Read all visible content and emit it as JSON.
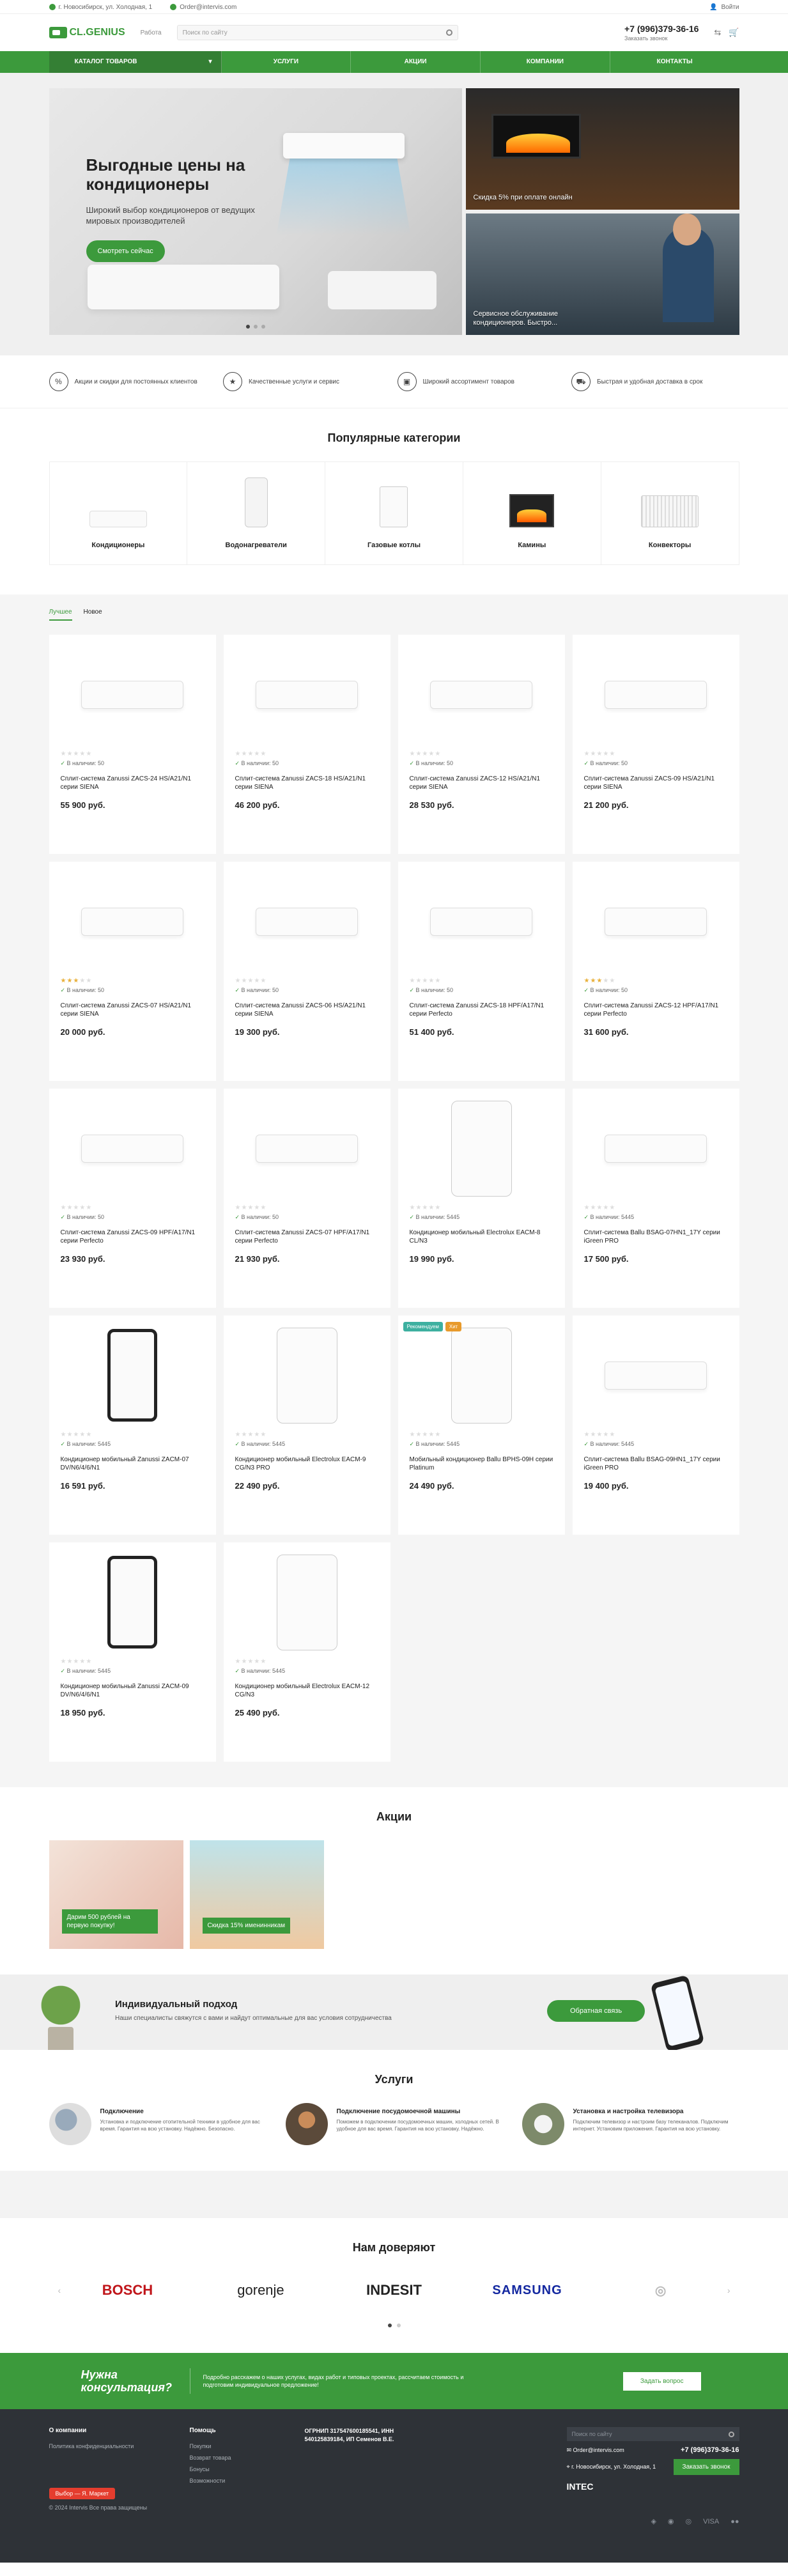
{
  "topbar": {
    "address": "г. Новосибирск, ул. Холодная, 1",
    "email": "Order@intervis.com",
    "right": "Войти"
  },
  "header": {
    "logo": "CL.GENIUS",
    "city": "Работа",
    "search_placeholder": "Поиск по сайту",
    "phone": "+7 (996)379-36-16",
    "callback": "Заказать звонок"
  },
  "nav": {
    "catalog": "Каталог товаров",
    "items": [
      "Услуги",
      "Акции",
      "Компании",
      "Контакты"
    ]
  },
  "hero": {
    "title": "Выгодные цены на кондиционеры",
    "text": "Широкий выбор кондиционеров от ведущих мировых производителей",
    "button": "Смотреть сейчас",
    "side1": "Скидка 5% при оплате онлайн",
    "side2": "Сервисное обслуживание кондиционеров. Быстро..."
  },
  "features": [
    {
      "icon": "percent-icon",
      "text": "Акции и скидки для постоянных клиентов"
    },
    {
      "icon": "award-icon",
      "text": "Качественные услуги и сервис"
    },
    {
      "icon": "shirt-icon",
      "text": "Широкий ассортимент товаров"
    },
    {
      "icon": "truck-icon",
      "text": "Быстрая и удобная доставка в срок"
    }
  ],
  "categories": {
    "title": "Популярные категории",
    "items": [
      "Кондиционеры",
      "Водонагреватели",
      "Газовые котлы",
      "Камины",
      "Конвекторы"
    ]
  },
  "tabs": [
    "Лучшее",
    "Новое"
  ],
  "products": [
    {
      "name": "Сплит-система Zanussi ZACS-24 HS/A21/N1 серии SIENA",
      "price": "55 900 руб.",
      "stock": "В наличии: 50",
      "stars": 0,
      "img": "wall"
    },
    {
      "name": "Сплит-система Zanussi ZACS-18 HS/A21/N1 серии SIENA",
      "price": "46 200 руб.",
      "stock": "В наличии: 50",
      "stars": 0,
      "img": "wall"
    },
    {
      "name": "Сплит-система Zanussi ZACS-12 HS/A21/N1 серии SIENA",
      "price": "28 530 руб.",
      "stock": "В наличии: 50",
      "stars": 0,
      "img": "wall"
    },
    {
      "name": "Сплит-система Zanussi ZACS-09 HS/A21/N1 серии SIENA",
      "price": "21 200 руб.",
      "stock": "В наличии: 50",
      "stars": 0,
      "img": "wall"
    },
    {
      "name": "Сплит-система Zanussi ZACS-07 HS/A21/N1 серии SIENA",
      "price": "20 000 руб.",
      "stock": "В наличии: 50",
      "stars": 3,
      "img": "wall"
    },
    {
      "name": "Сплит-система Zanussi ZACS-06 HS/A21/N1 серии SIENA",
      "price": "19 300 руб.",
      "stock": "В наличии: 50",
      "stars": 0,
      "img": "wall"
    },
    {
      "name": "Сплит-система Zanussi ZACS-18 HPF/A17/N1 серии Perfecto",
      "price": "51 400 руб.",
      "stock": "В наличии: 50",
      "stars": 0,
      "img": "wall"
    },
    {
      "name": "Сплит-система Zanussi ZACS-12 HPF/A17/N1 серии Perfecto",
      "price": "31 600 руб.",
      "stock": "В наличии: 50",
      "stars": 3,
      "img": "wall"
    },
    {
      "name": "Сплит-система Zanussi ZACS-09 HPF/A17/N1 серии Perfecto",
      "price": "23 930 руб.",
      "stock": "В наличии: 50",
      "stars": 0,
      "img": "wall"
    },
    {
      "name": "Сплит-система Zanussi ZACS-07 HPF/A17/N1 серии Perfecto",
      "price": "21 930 руб.",
      "stock": "В наличии: 50",
      "stars": 0,
      "img": "wall"
    },
    {
      "name": "Кондиционер мобильный Electrolux EACM-8 CL/N3",
      "price": "19 990 руб.",
      "stock": "В наличии: 5445",
      "stars": 0,
      "img": "mob"
    },
    {
      "name": "Сплит-система Ballu BSAG-07HN1_17Y серии iGreen PRO",
      "price": "17 500 руб.",
      "stock": "В наличии: 5445",
      "stars": 0,
      "img": "wall"
    },
    {
      "name": "Кондиционер мобильный Zanussi ZACM-07 DV/N6/4/6/N1",
      "price": "16 591 руб.",
      "stock": "В наличии: 5445",
      "stars": 0,
      "img": "mob-dark"
    },
    {
      "name": "Кондиционер мобильный Electrolux EACM-9 CG/N3 PRO",
      "price": "22 490 руб.",
      "stock": "В наличии: 5445",
      "stars": 0,
      "img": "mob"
    },
    {
      "name": "Мобильный кондиционер Ballu BPHS-09H серии Platinum",
      "price": "24 490 руб.",
      "stock": "В наличии: 5445",
      "stars": 0,
      "img": "mob",
      "badges": [
        "Рекомендуем",
        "Хит"
      ]
    },
    {
      "name": "Сплит-система Ballu BSAG-09HN1_17Y серии iGreen PRO",
      "price": "19 400 руб.",
      "stock": "В наличии: 5445",
      "stars": 0,
      "img": "wall"
    },
    {
      "name": "Кондиционер мобильный Zanussi ZACM-09 DV/N6/4/6/N1",
      "price": "18 950 руб.",
      "stock": "В наличии: 5445",
      "stars": 0,
      "img": "mob-dark"
    },
    {
      "name": "Кондиционер мобильный Electrolux EACM-12 CG/N3",
      "price": "25 490 руб.",
      "stock": "В наличии: 5445",
      "stars": 0,
      "img": "mob"
    }
  ],
  "promos": {
    "title": "Акции",
    "items": [
      "Дарим 500 рублей на первую покупку!",
      "Скидка 15% именинникам"
    ]
  },
  "indiv": {
    "title": "Индивидуальный подход",
    "text": "Наши специалисты свяжутся с вами и найдут оптимальные для вас условия сотрудничества",
    "button": "Обратная связь"
  },
  "services": {
    "title": "Услуги",
    "items": [
      {
        "title": "Подключение",
        "text": "Установка и подключение отопительной техники в удобное для вас время. Гарантия на всю установку. Надёжно. Безопасно."
      },
      {
        "title": "Подключение посудомоечной машины",
        "text": "Поможем в подключении посудомоечных машин, холодных сетей. В удобное для вас время. Гарантия на всю установку. Надёжно."
      },
      {
        "title": "Установка и настройка телевизора",
        "text": "Подключим телевизор и настроим базу телеканалов. Подключим интернет. Установим приложения. Гарантия на всю установку."
      }
    ]
  },
  "brands": {
    "title": "Нам доверяют",
    "items": [
      "BOSCH",
      "gorenje",
      "INDESIT",
      "SAMSUNG",
      "◎"
    ]
  },
  "consult": {
    "question": "Нужна консультация?",
    "text": "Подробно расскажем о наших услугах, видах работ и типовых проектах, рассчитаем стоимость и подготовим индивидуальное предложение!",
    "button": "Задать вопрос"
  },
  "footer": {
    "col1": {
      "title": "О компании",
      "items": [
        "Политика конфиденциальности"
      ]
    },
    "col2": {
      "title": "Помощь",
      "items": [
        "Покупки",
        "Возврат товара",
        "Бонусы",
        "Возможности"
      ]
    },
    "col3": "ОГРНИП 317547600185541, ИНН 540125839184, ИП Семенов В.Е.",
    "search_placeholder": "Поиск по сайту",
    "email": "Order@intervis.com",
    "phone": "+7 (996)379-36-16",
    "address": "г. Новосибирск, ул. Холодная, 1",
    "callback": "Заказать звонок",
    "dev": "INTEC",
    "yandex": "Выбор — Я. Маркет",
    "copyright": "© 2024 Intervis Все права защищены",
    "payments": [
      "◈",
      "◉",
      "◎",
      "VISA",
      "●●"
    ]
  }
}
